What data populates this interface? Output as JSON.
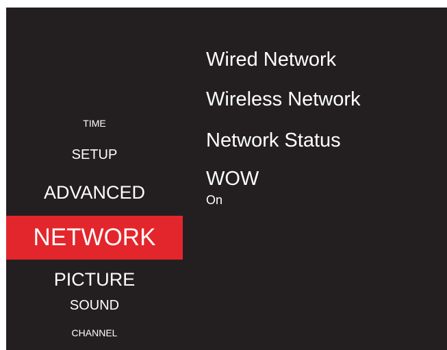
{
  "colors": {
    "background": "#231f20",
    "text": "#ffffff",
    "selected_highlight": "#e3262c"
  },
  "left_menu": {
    "items": [
      {
        "label": "TIME"
      },
      {
        "label": "SETUP"
      },
      {
        "label": "ADVANCED"
      },
      {
        "label": "NETWORK",
        "selected": true
      },
      {
        "label": "PICTURE"
      },
      {
        "label": "SOUND"
      },
      {
        "label": "CHANNEL"
      }
    ]
  },
  "network_menu": {
    "items": [
      {
        "label": "Wired Network"
      },
      {
        "label": "Wireless Network"
      },
      {
        "label": "Network Status"
      },
      {
        "label": "WOW",
        "value": "On"
      }
    ]
  }
}
